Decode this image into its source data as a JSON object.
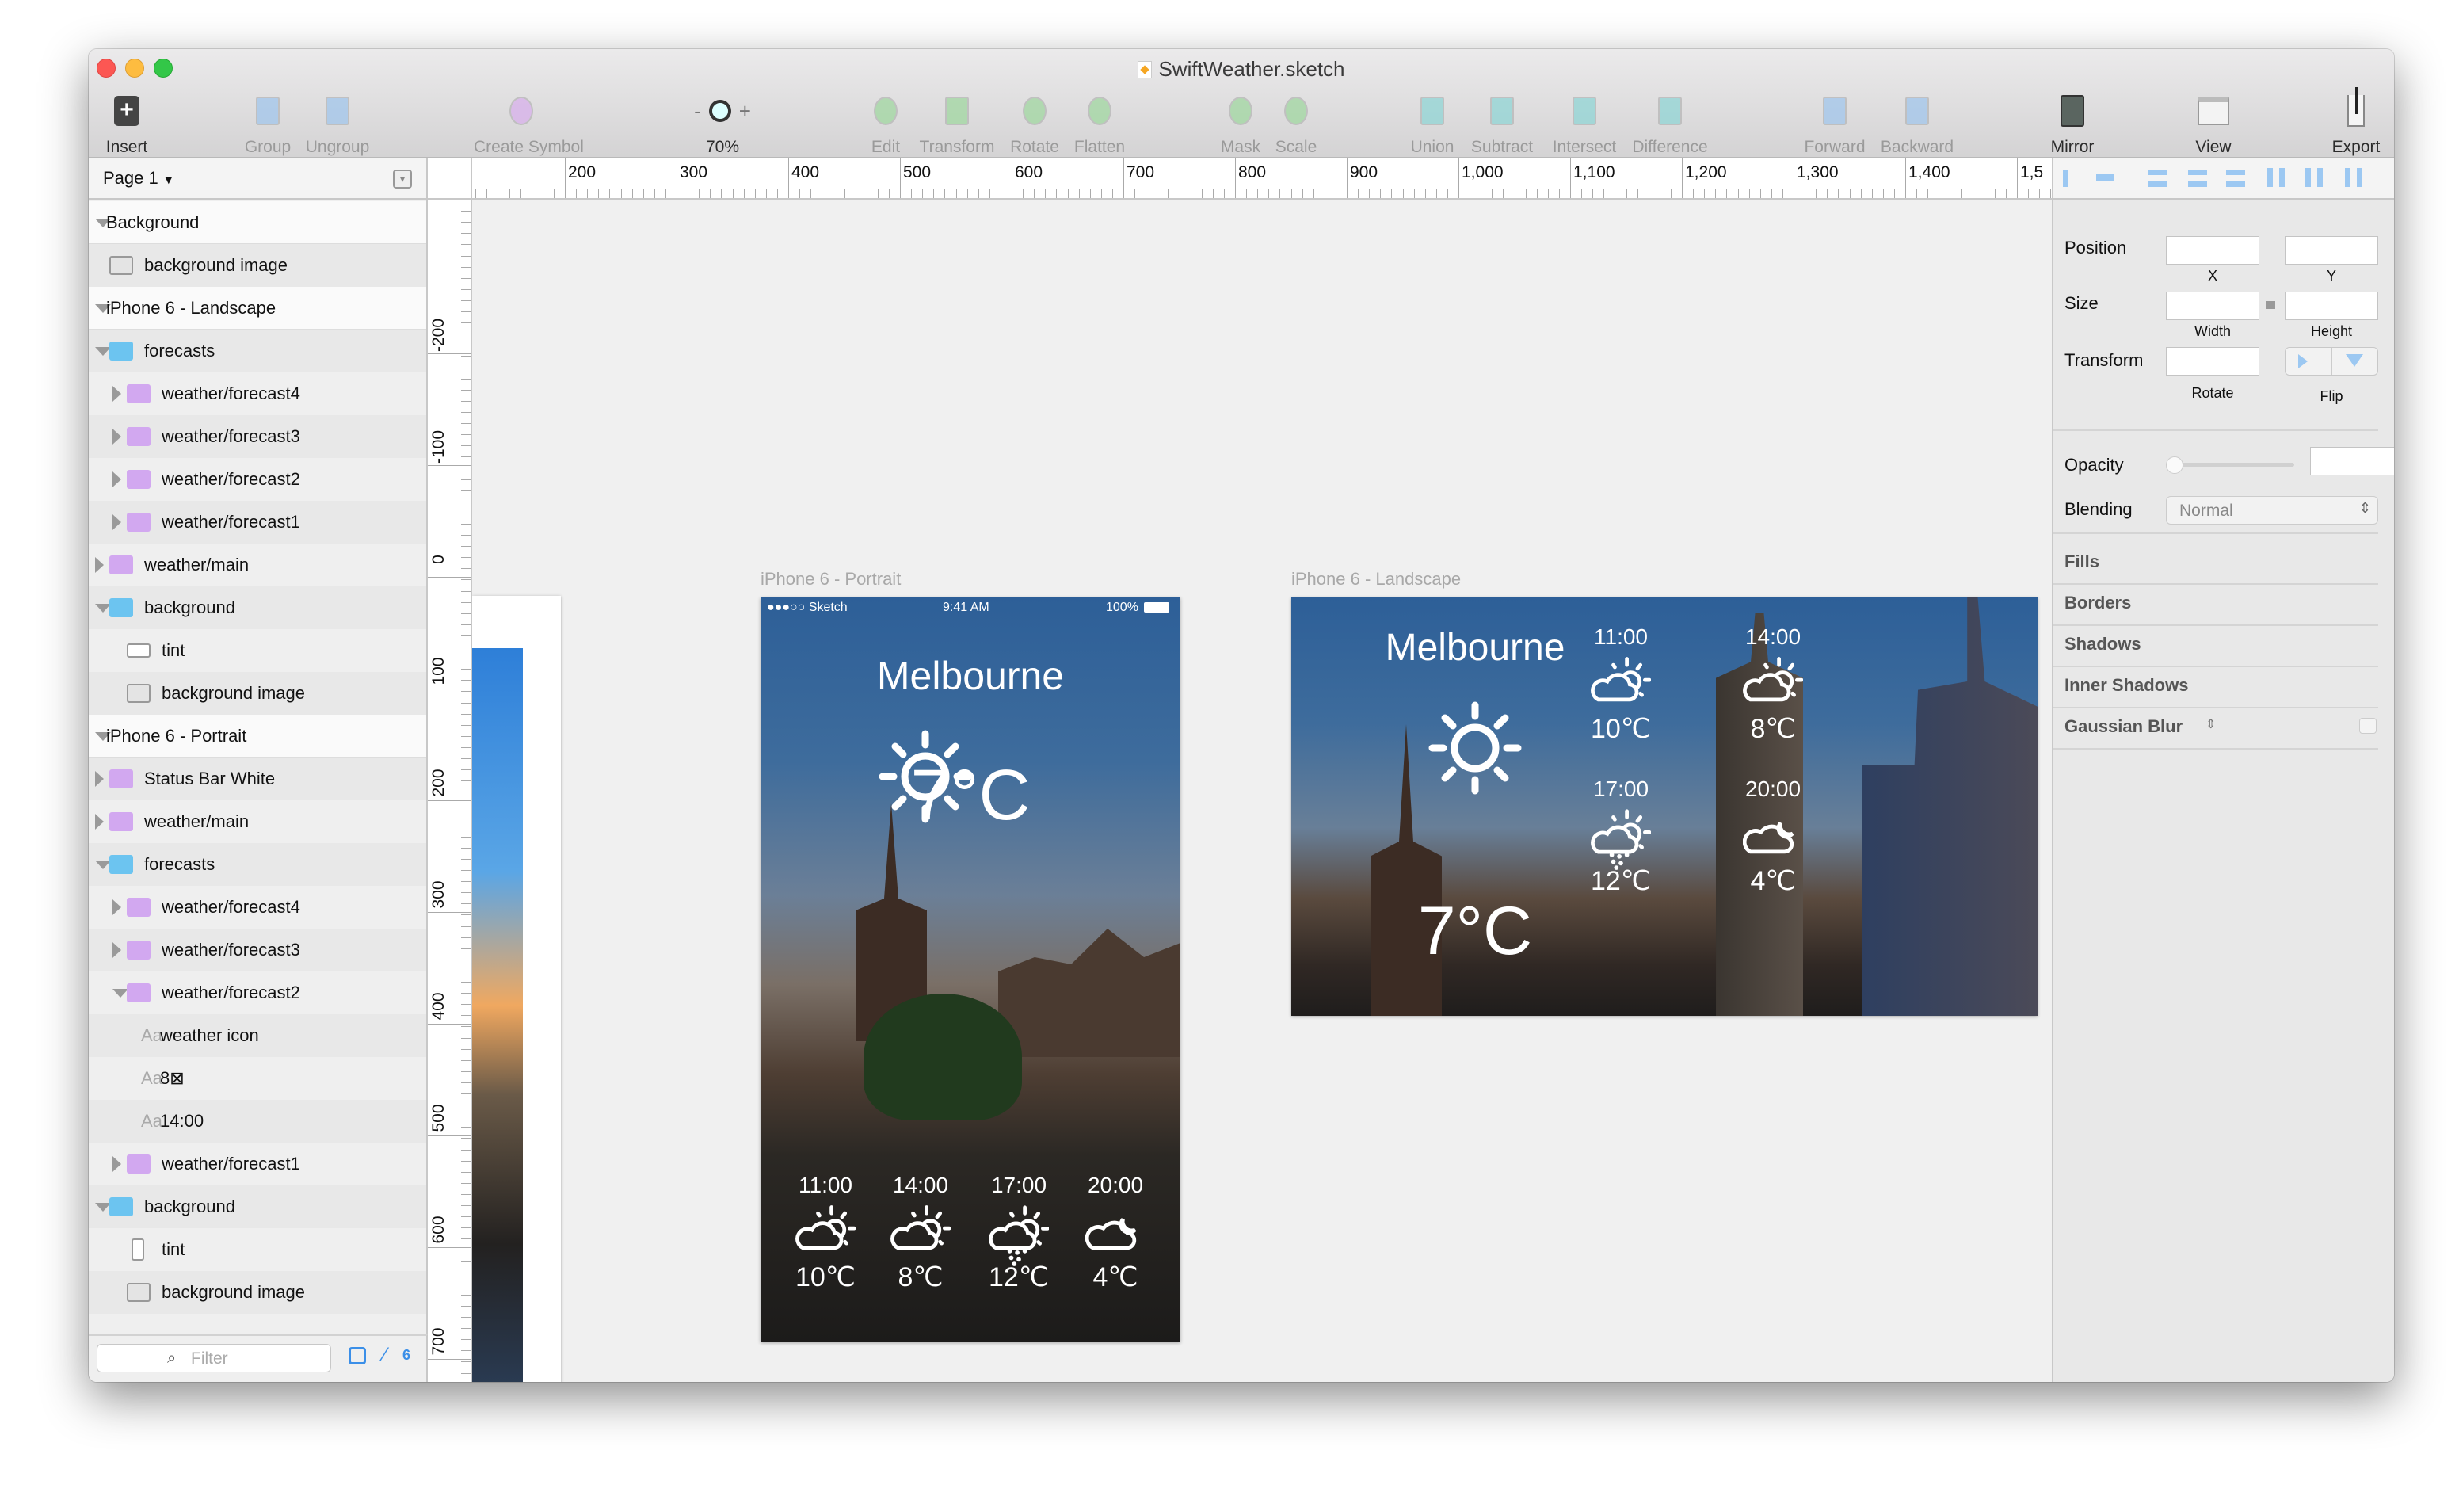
{
  "window": {
    "title": "SwiftWeather.sketch"
  },
  "toolbar": {
    "items": [
      {
        "label": "Insert",
        "icon": "plus-icon",
        "enabled": true
      },
      {
        "label": "Group",
        "icon": "group-icon",
        "enabled": false
      },
      {
        "label": "Ungroup",
        "icon": "ungroup-icon",
        "enabled": false
      },
      {
        "label": "Create Symbol",
        "icon": "symbol-icon",
        "enabled": false
      },
      {
        "label": "70%",
        "icon": "zoom-icon",
        "enabled": true
      },
      {
        "label": "Edit",
        "icon": "edit-icon",
        "enabled": false
      },
      {
        "label": "Transform",
        "icon": "transform-icon",
        "enabled": false
      },
      {
        "label": "Rotate",
        "icon": "rotate-icon",
        "enabled": false
      },
      {
        "label": "Flatten",
        "icon": "flatten-icon",
        "enabled": false
      },
      {
        "label": "Mask",
        "icon": "mask-icon",
        "enabled": false
      },
      {
        "label": "Scale",
        "icon": "scale-icon",
        "enabled": false
      },
      {
        "label": "Union",
        "icon": "union-icon",
        "enabled": false
      },
      {
        "label": "Subtract",
        "icon": "subtract-icon",
        "enabled": false
      },
      {
        "label": "Intersect",
        "icon": "intersect-icon",
        "enabled": false
      },
      {
        "label": "Difference",
        "icon": "difference-icon",
        "enabled": false
      },
      {
        "label": "Forward",
        "icon": "forward-icon",
        "enabled": false
      },
      {
        "label": "Backward",
        "icon": "backward-icon",
        "enabled": false
      },
      {
        "label": "Mirror",
        "icon": "mirror-icon",
        "enabled": true
      },
      {
        "label": "View",
        "icon": "view-icon",
        "enabled": true
      },
      {
        "label": "Export",
        "icon": "export-icon",
        "enabled": true
      }
    ],
    "zoom_minus": "-",
    "zoom_plus": "+"
  },
  "page_selector": {
    "label": "Page 1"
  },
  "rulers": {
    "horizontal": [
      "200",
      "300",
      "400",
      "500",
      "600",
      "700",
      "800",
      "900",
      "1,000",
      "1,100",
      "1,200",
      "1,300",
      "1,400",
      "1,5"
    ],
    "vertical": [
      "-200",
      "-100",
      "0",
      "100",
      "200",
      "300",
      "400",
      "500",
      "600",
      "700"
    ]
  },
  "layers": [
    {
      "label": "Background",
      "type": "artboard",
      "level": 0,
      "state": "open"
    },
    {
      "label": "background image",
      "type": "image",
      "level": 1,
      "state": "none"
    },
    {
      "label": "iPhone 6 - Landscape",
      "type": "artboard",
      "level": 0,
      "state": "open"
    },
    {
      "label": "forecasts",
      "type": "folder",
      "level": 1,
      "state": "open"
    },
    {
      "label": "weather/forecast4",
      "type": "symbol",
      "level": 2,
      "state": "closed"
    },
    {
      "label": "weather/forecast3",
      "type": "symbol",
      "level": 2,
      "state": "closed"
    },
    {
      "label": "weather/forecast2",
      "type": "symbol",
      "level": 2,
      "state": "closed"
    },
    {
      "label": "weather/forecast1",
      "type": "symbol",
      "level": 2,
      "state": "closed"
    },
    {
      "label": "weather/main",
      "type": "symbol",
      "level": 1,
      "state": "closed"
    },
    {
      "label": "background",
      "type": "folder-mask",
      "level": 1,
      "state": "open"
    },
    {
      "label": "tint",
      "type": "rect",
      "level": 2,
      "state": "none"
    },
    {
      "label": "background image",
      "type": "image",
      "level": 2,
      "state": "none"
    },
    {
      "label": "iPhone 6 - Portrait",
      "type": "artboard",
      "level": 0,
      "state": "open"
    },
    {
      "label": "Status Bar White",
      "type": "symbol",
      "level": 1,
      "state": "closed"
    },
    {
      "label": "weather/main",
      "type": "symbol",
      "level": 1,
      "state": "closed"
    },
    {
      "label": "forecasts",
      "type": "folder",
      "level": 1,
      "state": "open"
    },
    {
      "label": "weather/forecast4",
      "type": "symbol",
      "level": 2,
      "state": "closed"
    },
    {
      "label": "weather/forecast3",
      "type": "symbol",
      "level": 2,
      "state": "closed"
    },
    {
      "label": "weather/forecast2",
      "type": "symbol",
      "level": 2,
      "state": "open"
    },
    {
      "label": "weather icon",
      "type": "text",
      "level": 3,
      "state": "none"
    },
    {
      "label": "8⊠",
      "type": "text",
      "level": 3,
      "state": "none"
    },
    {
      "label": "14:00",
      "type": "text",
      "level": 3,
      "state": "none"
    },
    {
      "label": "weather/forecast1",
      "type": "symbol",
      "level": 2,
      "state": "closed"
    },
    {
      "label": "background",
      "type": "folder-mask",
      "level": 1,
      "state": "open"
    },
    {
      "label": "tint",
      "type": "rect-tall",
      "level": 2,
      "state": "none"
    },
    {
      "label": "background image",
      "type": "image",
      "level": 2,
      "state": "none"
    }
  ],
  "text_layer_glyph": "Aa",
  "filter": {
    "placeholder": "Filter",
    "slice_count": "6"
  },
  "inspector": {
    "position": "Position",
    "x": "X",
    "y": "Y",
    "size": "Size",
    "width": "Width",
    "height": "Height",
    "transform": "Transform",
    "rotate": "Rotate",
    "flip": "Flip",
    "opacity": "Opacity",
    "opacity_value": 0,
    "blending": "Blending",
    "blending_value": "Normal",
    "sections": [
      "Fills",
      "Borders",
      "Shadows",
      "Inner Shadows",
      "Gaussian Blur"
    ]
  },
  "portrait": {
    "label": "iPhone 6 - Portrait",
    "status": {
      "carrier": "●●●○○ Sketch",
      "time": "9:41 AM",
      "battery": "100%"
    },
    "city": "Melbourne",
    "temp": "7°C",
    "forecasts": [
      {
        "time": "11:00",
        "temp": "10℃",
        "icon": "cloud-sun-icon"
      },
      {
        "time": "14:00",
        "temp": "8℃",
        "icon": "cloud-sun-icon"
      },
      {
        "time": "17:00",
        "temp": "12℃",
        "icon": "cloud-sun-rain-icon"
      },
      {
        "time": "20:00",
        "temp": "4℃",
        "icon": "cloud-moon-icon"
      }
    ]
  },
  "landscape": {
    "label": "iPhone 6 - Landscape",
    "city": "Melbourne",
    "temp": "7°C",
    "forecasts": [
      {
        "time": "11:00",
        "temp": "10℃",
        "icon": "cloud-sun-icon"
      },
      {
        "time": "14:00",
        "temp": "8℃",
        "icon": "cloud-sun-icon"
      },
      {
        "time": "17:00",
        "temp": "12℃",
        "icon": "cloud-sun-rain-icon"
      },
      {
        "time": "20:00",
        "temp": "4℃",
        "icon": "cloud-moon-icon"
      }
    ]
  },
  "colors": {
    "accent": "#4a90e2",
    "folder": "#6cc4f0",
    "symbol": "#d2a8f0"
  }
}
